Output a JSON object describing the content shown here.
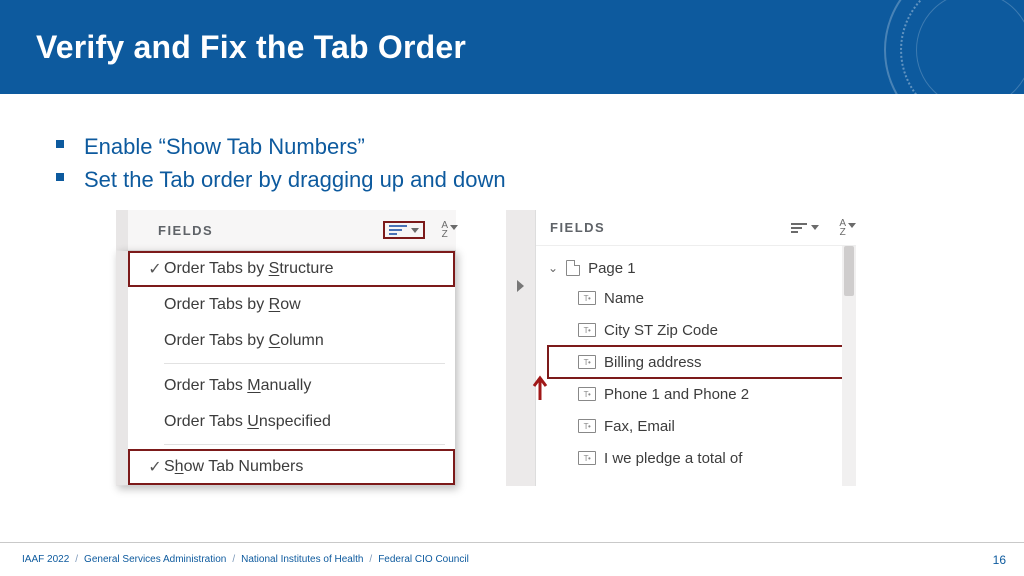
{
  "header": {
    "title": "Verify and Fix the Tab Order"
  },
  "bullets": [
    "Enable “Show Tab Numbers”",
    "Set the Tab order by dragging up and down"
  ],
  "panelA": {
    "label": "FIELDS",
    "az_top": "A",
    "az_bot": "Z",
    "menu": [
      {
        "pre": "Order Tabs by ",
        "u": "S",
        "post": "tructure",
        "checked": true,
        "highlight": true
      },
      {
        "pre": "Order Tabs by ",
        "u": "R",
        "post": "ow",
        "checked": false,
        "highlight": false
      },
      {
        "pre": "Order Tabs by ",
        "u": "C",
        "post": "olumn",
        "checked": false,
        "highlight": false
      },
      {
        "sep": true
      },
      {
        "pre": "Order Tabs ",
        "u": "M",
        "post": "anually",
        "checked": false,
        "highlight": false
      },
      {
        "pre": "Order Tabs ",
        "u": "U",
        "post": "nspecified",
        "checked": false,
        "highlight": false
      },
      {
        "sep": true
      },
      {
        "pre": "S",
        "u": "h",
        "post": "ow Tab Numbers",
        "checked": true,
        "highlight": true
      }
    ]
  },
  "panelB": {
    "label": "FIELDS",
    "az_top": "A",
    "az_bot": "Z",
    "page": "Page 1",
    "fields": [
      {
        "label": "Name",
        "highlight": false
      },
      {
        "label": "City ST  Zip Code",
        "highlight": false
      },
      {
        "label": "Billing address",
        "highlight": true
      },
      {
        "label": "Phone 1  and Phone 2",
        "highlight": false
      },
      {
        "label": "Fax, Email",
        "highlight": false
      },
      {
        "label": "I we pledge a total of",
        "highlight": false
      }
    ]
  },
  "footer": {
    "crumbs": [
      "IAAF 2022",
      "General Services Administration",
      "National Institutes of Health",
      "Federal CIO Council"
    ],
    "page": "16"
  }
}
